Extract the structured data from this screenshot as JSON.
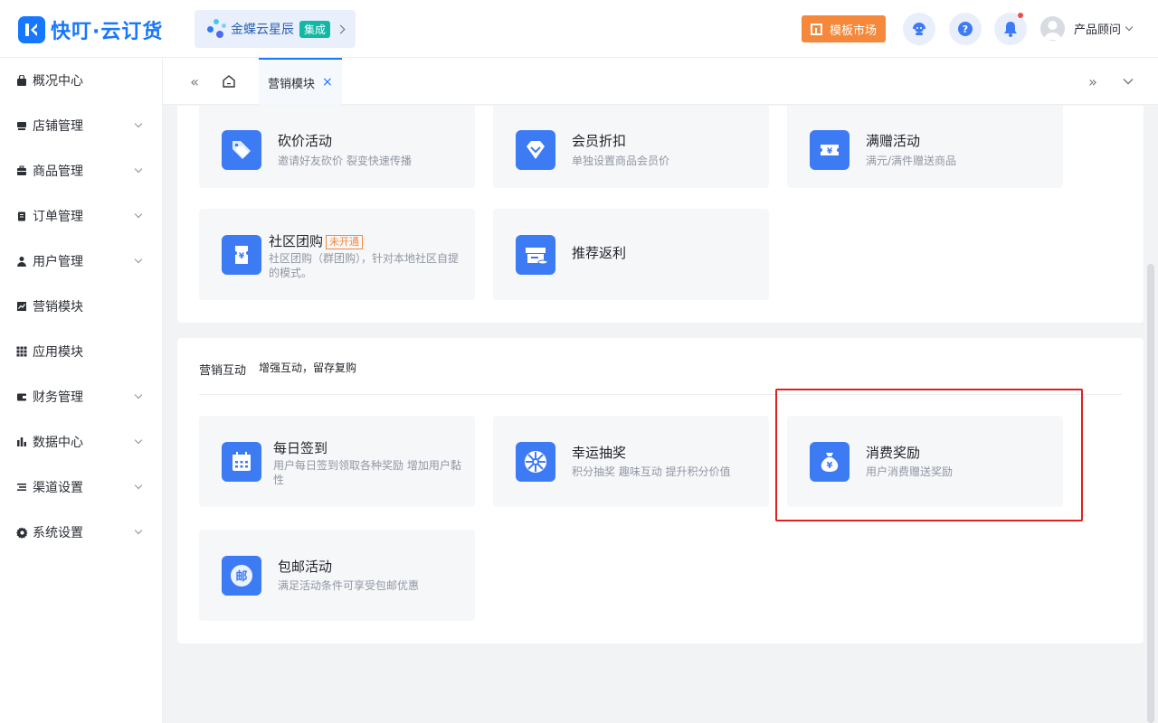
{
  "header": {
    "brand": "快叮·云订货",
    "integration": {
      "label": "金蝶云星辰",
      "badge": "集成"
    },
    "template_market": "模板市场",
    "user_name": "产品顾问"
  },
  "sidebar": {
    "items": [
      {
        "label": "概况中心",
        "icon": "bag-icon",
        "has_arrow": false
      },
      {
        "label": "店铺管理",
        "icon": "store-icon",
        "has_arrow": true
      },
      {
        "label": "商品管理",
        "icon": "briefcase-icon",
        "has_arrow": true
      },
      {
        "label": "订单管理",
        "icon": "clipboard-icon",
        "has_arrow": true
      },
      {
        "label": "用户管理",
        "icon": "user-icon",
        "has_arrow": true
      },
      {
        "label": "营销模块",
        "icon": "chart-icon",
        "has_arrow": false
      },
      {
        "label": "应用模块",
        "icon": "grid-icon",
        "has_arrow": false
      },
      {
        "label": "财务管理",
        "icon": "wallet-icon",
        "has_arrow": true
      },
      {
        "label": "数据中心",
        "icon": "bar-chart-icon",
        "has_arrow": true
      },
      {
        "label": "渠道设置",
        "icon": "list-icon",
        "has_arrow": true
      },
      {
        "label": "系统设置",
        "icon": "gear-icon",
        "has_arrow": true
      }
    ]
  },
  "tabs": {
    "active": "营销模块"
  },
  "section_top": {
    "cards": [
      {
        "title": "砍价活动",
        "desc": "邀请好友砍价 裂变快速传播",
        "icon": "price-tag-icon"
      },
      {
        "title": "会员折扣",
        "desc": "单独设置商品会员价",
        "icon": "diamond-icon"
      },
      {
        "title": "满赠活动",
        "desc": "满元/满件赠送商品",
        "icon": "ticket-icon"
      },
      {
        "title": "社区团购",
        "tag": "未开通",
        "desc": "社区团购（群团购），针对本地社区自提的模式。",
        "icon": "ticket-icon"
      },
      {
        "title": "推荐返利",
        "desc": "",
        "icon": "shop-coin-icon"
      }
    ]
  },
  "section_interact": {
    "title": "营销互动",
    "subtitle": "增强互动，留存复购",
    "cards": [
      {
        "title": "每日签到",
        "desc": "用户每日签到领取各种奖励 增加用户黏性",
        "icon": "calendar-icon"
      },
      {
        "title": "幸运抽奖",
        "desc": "积分抽奖 趣味互动 提升积分价值",
        "icon": "wheel-icon"
      },
      {
        "title": "消费奖励",
        "desc": "用户消费赠送奖励",
        "icon": "money-bag-icon"
      },
      {
        "title": "包邮活动",
        "desc": "满足活动条件可享受包邮优惠",
        "icon": "mail-icon"
      }
    ]
  },
  "colors": {
    "primary": "#1677ff",
    "icon_bg": "#3d7bf4",
    "orange": "#f5883a",
    "highlight": "#e02020"
  }
}
